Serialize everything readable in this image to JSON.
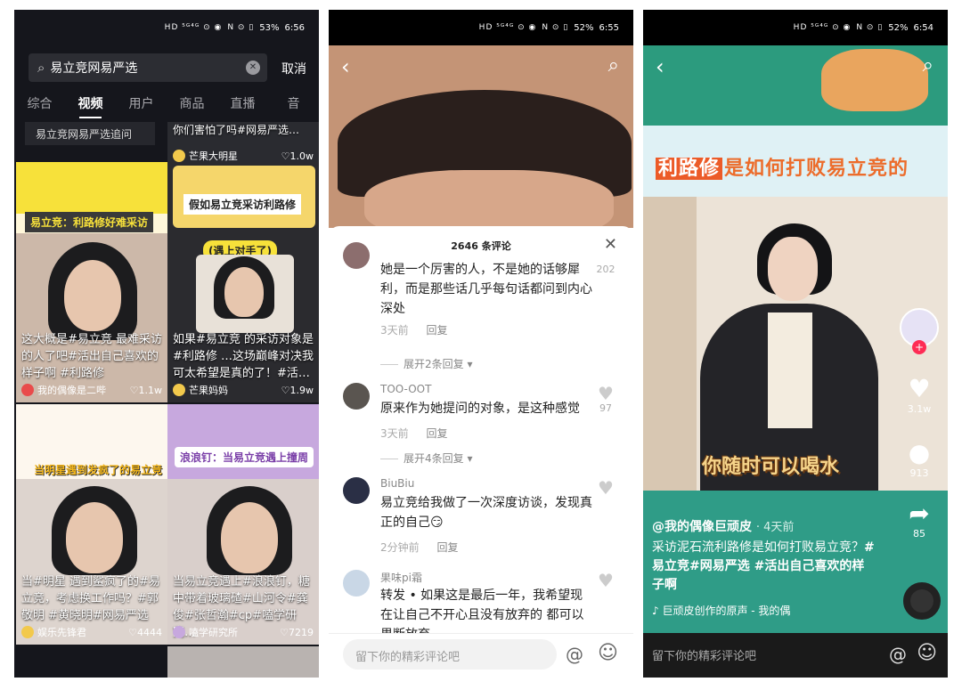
{
  "status": [
    {
      "icons": "HD ⁵ᴳ⁴ᴳ ⊙ ◉",
      "nfc": "N ⊙ ▯",
      "battery": "53%",
      "time": "6:56"
    },
    {
      "icons": "HD ⁵ᴳ⁴ᴳ ⊙ ◉",
      "nfc": "N ⊙ ▯",
      "battery": "52%",
      "time": "6:55"
    },
    {
      "icons": "HD ⁵ᴳ⁴ᴳ ⊙ ◉",
      "nfc": "N ⊙ ▯",
      "battery": "52%",
      "time": "6:54"
    }
  ],
  "search": {
    "query": "易立竞网易严选",
    "cancel": "取消",
    "tabs": [
      "综合",
      "视频",
      "用户",
      "商品",
      "直播",
      "音"
    ],
    "suggestion": "易立竞网易严选追问",
    "top_right_caption": "你们害怕了吗#网易严选…",
    "top_right_author": "芒果大明星",
    "top_right_likes": "♡1.0w"
  },
  "cards": [
    {
      "banner": "易立竞：利路修好难采访",
      "caption": "这大概是#易立竞 最难采访的人了吧#活出自己喜欢的样子啊 #利路修",
      "author": "我的偶像是二哔",
      "likes": "♡1.1w"
    },
    {
      "banner": "假如易立竞采访利路修",
      "sticker": "(遇上对手了)",
      "caption": "如果#易立竞 的采访对象是#利路修 …这场巅峰对决我可太希望是真的了！#活…",
      "author": "芒果妈妈",
      "likes": "♡1.9w"
    },
    {
      "banner": "当明星遇到发疯了的易立竞",
      "caption": "当#明星 遇到鲨疯了的#易立竞，考虑换工作吗？#郭敬明 #黄晓明#网易严选",
      "author": "娱乐先锋君",
      "likes": "♡4444"
    },
    {
      "banner": "浪浪钉：当易立竞遇上撞周",
      "caption": "当易立竞遇上#浪浪钉，糖中带着玻璃碴#山河令#龚俊#张哲瀚#cp#嗑学研究…",
      "author": "嗑学研究所",
      "likes": "♡7219"
    }
  ],
  "comments": {
    "header": "2646 条评论",
    "close": "✕",
    "items": [
      {
        "name": "",
        "text": "她是一个厉害的人，不是她的话够犀利，而是那些话几乎每句话都问到内心深处",
        "time": "3天前",
        "reply": "回复",
        "likes": "202",
        "more": "展开2条回复 ▾"
      },
      {
        "name": "TOO-OOT",
        "text": "原来作为她提问的对象，是这种感觉",
        "time": "3天前",
        "reply": "回复",
        "likes": "97",
        "more": "展开4条回复 ▾"
      },
      {
        "name": "BiuBiu",
        "text": "易立竞给我做了一次深度访谈，发现真正的自己😏",
        "time": "2分钟前",
        "reply": "回复",
        "likes": ""
      },
      {
        "name": "果味pi霜",
        "text": "转发 • 如果这是最后一年，我希望现在让自己不开心且没有放弃的 都可以果断放弃",
        "time": "",
        "reply": "",
        "likes": ""
      }
    ],
    "input_placeholder": "留下你的精彩评论吧"
  },
  "video": {
    "title_highlight": "利路修",
    "title_rest": "是如何打败易立竞的",
    "subtitle": "你随时可以喝水",
    "likes": "3.1w",
    "comments": "913",
    "shares": "85",
    "user": "@我的偶像巨顽皮",
    "when": "· 4天前",
    "desc_plain": "采访泥石流利路修是如何打败易立竞？",
    "desc_tags": "#易立竞#网易严选 #活出自己喜欢的样子啊",
    "music": "♪ 巨顽皮创作的原声 - 我的偶",
    "input_placeholder": "留下你的精彩评论吧"
  },
  "colors": {
    "accent_orange": "#ec5b28",
    "teal": "#2f9c87",
    "like_red": "#fe2c55"
  }
}
